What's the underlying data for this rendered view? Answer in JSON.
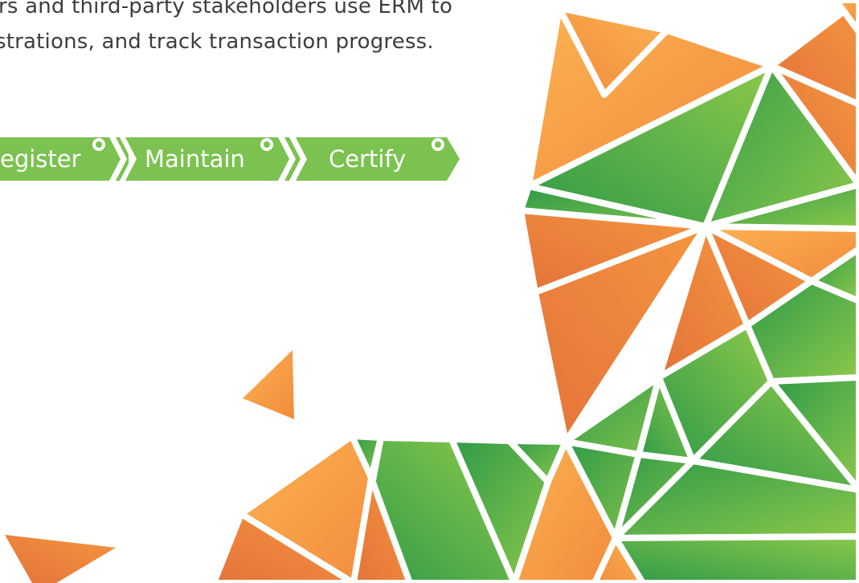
{
  "intro": {
    "line1": "rs and third-party stakeholders use ERM to",
    "line2": "strations, and track transaction progress."
  },
  "steps": [
    {
      "label": "egister",
      "dot_icon": "ring-dot-icon"
    },
    {
      "label": "Maintain",
      "dot_icon": "ring-dot-icon"
    },
    {
      "label": "Certify",
      "dot_icon": "ring-dot-icon"
    }
  ],
  "colors": {
    "step_green": "#7bc250",
    "text": "#3d3d3d",
    "orange_light": "#fbb252",
    "orange_mid": "#f28b3c",
    "orange_dark": "#e4733a",
    "green_light": "#8cc84b",
    "green_mid": "#5aa845",
    "green_dark": "#2e9a48"
  }
}
